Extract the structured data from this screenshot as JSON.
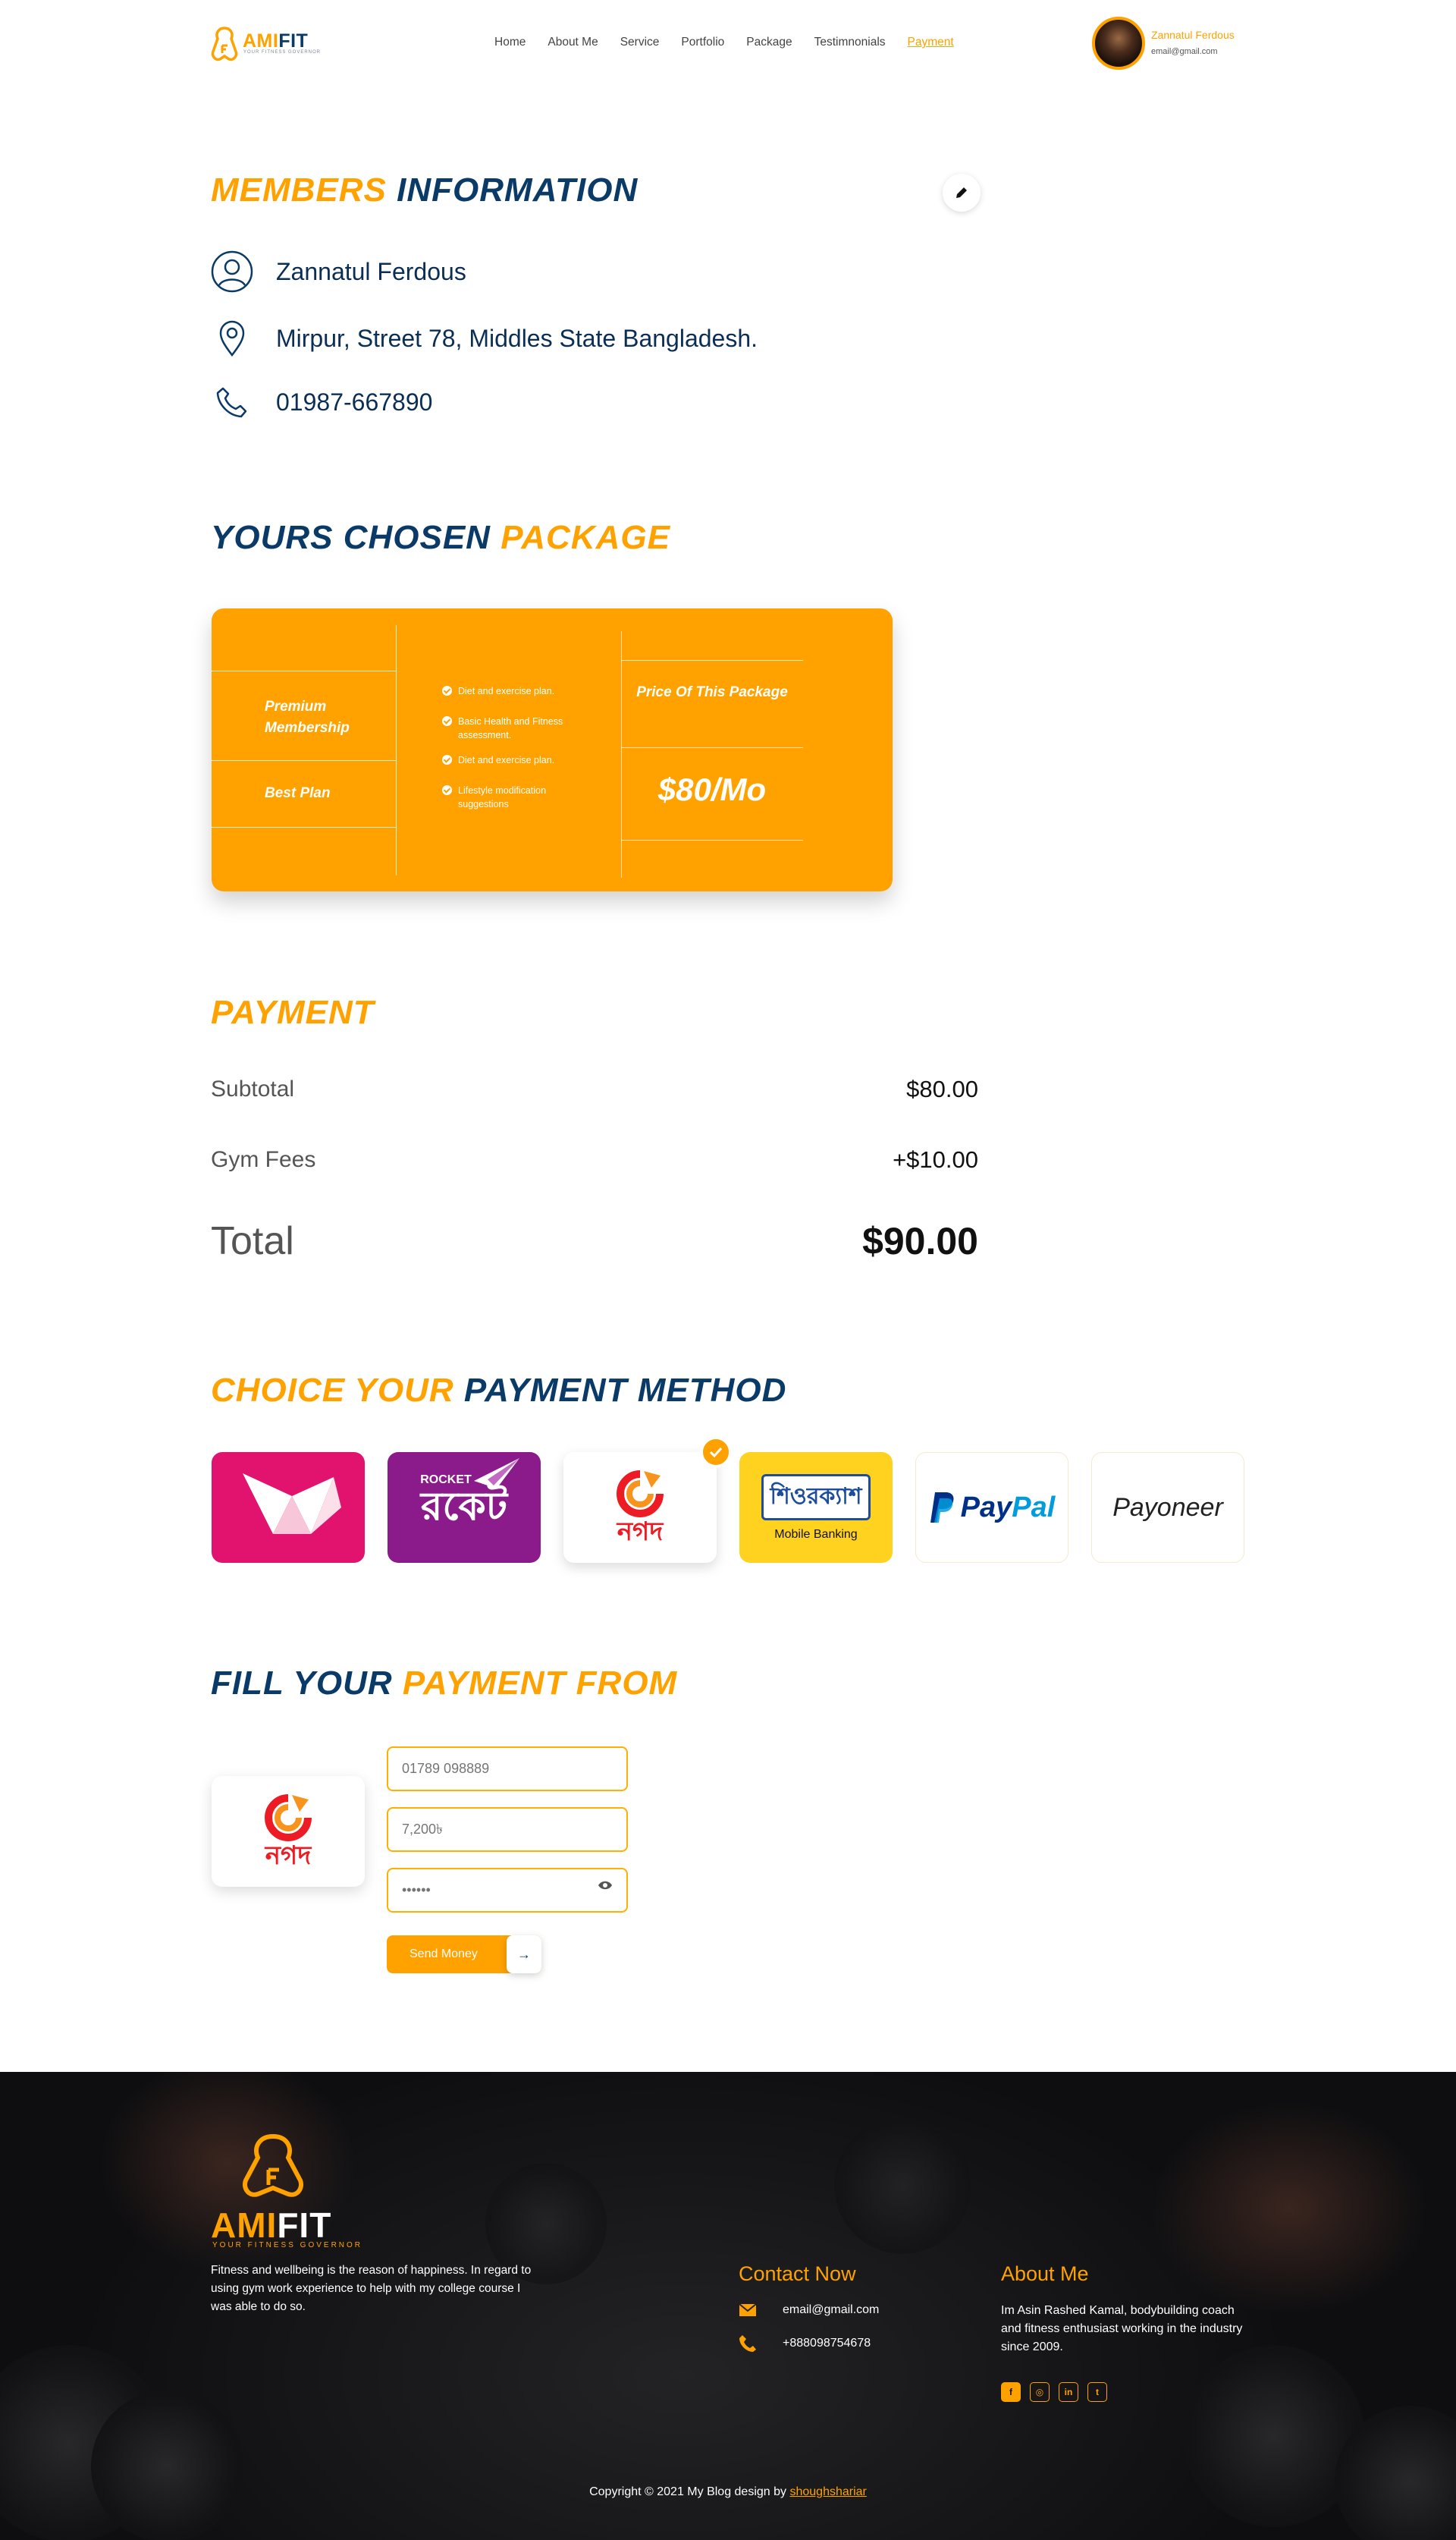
{
  "brand": {
    "name_a": "AMI",
    "name_b": "FIT",
    "tagline": "YOUR FITNESS GOVERNOR"
  },
  "nav": {
    "items": [
      "Home",
      "About Me",
      "Service",
      "Portfolio",
      "Package",
      "Testimnonials",
      "Payment"
    ],
    "active": "Payment"
  },
  "user": {
    "name": "Zannatul Ferdous",
    "email": "email@gmail.com"
  },
  "members": {
    "title_a": "MEMBERS",
    "title_b": "INFORMATION",
    "name": "Zannatul Ferdous",
    "address": "Mirpur, Street 78, Middles State Bangladesh.",
    "phone": "01987-667890"
  },
  "package": {
    "title_a": "YOURS CHOSEN",
    "title_b": "PACKAGE",
    "tier": "Premium Membership",
    "plan_label": "Best Plan",
    "features": [
      "Diet and exercise plan.",
      "Basic Health and Fitness assessment.",
      "Diet and exercise plan.",
      "Lifestyle modification suggestions"
    ],
    "price_label": "Price Of This Package",
    "price": "$80/Mo"
  },
  "payment": {
    "title": "PAYMENT",
    "subtotal_label": "Subtotal",
    "subtotal": "$80.00",
    "fees_label": "Gym Fees",
    "fees": "+$10.00",
    "total_label": "Total",
    "total": "$90.00"
  },
  "methods": {
    "title_a": "CHOICE YOUR",
    "title_b": "PAYMENT METHOD",
    "items": [
      {
        "name": "bkash-method",
        "color": "#e2136e"
      },
      {
        "name": "rocket-method",
        "color": "#8b1a8b",
        "label": "ROCKET"
      },
      {
        "name": "nagad-method",
        "label": "নগদ"
      },
      {
        "name": "surecash-method",
        "label": "শিওরক্যাশ",
        "sub": "Mobile Banking",
        "color": "#ffd21f"
      },
      {
        "name": "paypal-method",
        "label_a": "Pay",
        "label_b": "Pal"
      },
      {
        "name": "payoneer-method",
        "label": "Payoneer"
      }
    ],
    "selected": "nagad-method"
  },
  "form": {
    "title_a": "FILL YOUR",
    "title_b": "PAYMENT FROM",
    "phone": "01789 098889",
    "amount": "7,200৳",
    "pin": "••••••",
    "submit_label": "Send Money",
    "logo_label": "নগদ"
  },
  "footer": {
    "description": "Fitness and wellbeing is the reason of happiness. In regard to using gym work experience to help with my college course I was able to do so.",
    "contact_title": "Contact Now",
    "email": "email@gmail.com",
    "phone": "+888098754678",
    "about_title": "About Me",
    "about": "Im Asin Rashed Kamal, bodybuilding coach and fitness enthusiast working in the industry since 2009.",
    "socials": [
      "f",
      "◎",
      "in",
      "t"
    ],
    "copyright_prefix": "Copyright © 2021 My Blog design by",
    "copyright_author": "shoughshariar"
  },
  "colors": {
    "accent": "#ffa200",
    "navy": "#0a3a68"
  }
}
